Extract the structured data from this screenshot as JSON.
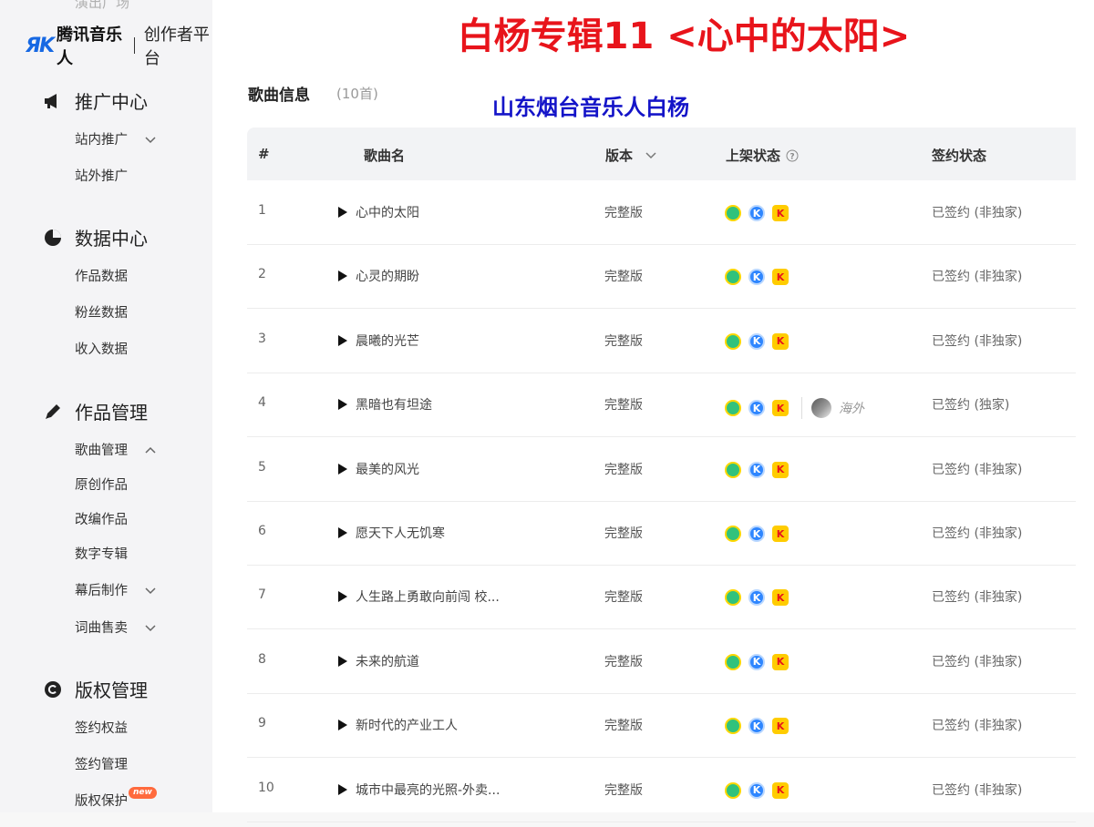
{
  "colors": {
    "accent": "#1668e3",
    "title_red": "#e8141b",
    "artist_blue": "#1414c8",
    "badge_orange": "#ff6a3d"
  },
  "sidebar": {
    "cut_text": "演出广场",
    "logo": {
      "mark": "ЯK",
      "name": "腾讯音乐人",
      "sub": "创作者平台"
    },
    "groups": [
      {
        "label": "推广中心",
        "icon": "megaphone-icon"
      },
      {
        "label": "数据中心",
        "icon": "pie-chart-icon"
      },
      {
        "label": "作品管理",
        "icon": "pencil-icon"
      },
      {
        "label": "版权管理",
        "icon": "copyright-icon"
      }
    ],
    "items": [
      {
        "label": "站内推广"
      },
      {
        "label": "站外推广"
      },
      {
        "label": "作品数据"
      },
      {
        "label": "粉丝数据"
      },
      {
        "label": "收入数据"
      },
      {
        "label": "歌曲管理"
      },
      {
        "label": "原创作品"
      },
      {
        "label": "改编作品"
      },
      {
        "label": "数字专辑"
      },
      {
        "label": "幕后制作"
      },
      {
        "label": "词曲售卖"
      },
      {
        "label": "签约权益"
      },
      {
        "label": "签约管理"
      },
      {
        "label": "版权保护",
        "badge": "new"
      }
    ]
  },
  "overlay": {
    "album_title": "白杨专辑11 <心中的太阳>",
    "artist": "山东烟台音乐人白杨"
  },
  "section": {
    "title": "歌曲信息",
    "count": "(10首)"
  },
  "table": {
    "headers": {
      "index": "#",
      "name": "歌曲名",
      "version": "版本",
      "status": "上架状态",
      "sign": "签约状态"
    },
    "rows": [
      {
        "index": "1",
        "name": "心中的太阳",
        "version": "完整版",
        "sign": "已签约 (非独家)"
      },
      {
        "index": "2",
        "name": "心灵的期盼",
        "version": "完整版",
        "sign": "已签约 (非独家)"
      },
      {
        "index": "3",
        "name": "晨曦的光芒",
        "version": "完整版",
        "sign": "已签约 (非独家)"
      },
      {
        "index": "4",
        "name": "黑暗也有坦途",
        "version": "完整版",
        "sign": "已签约 (独家)",
        "overseas": "海外"
      },
      {
        "index": "5",
        "name": "最美的风光",
        "version": "完整版",
        "sign": "已签约 (非独家)"
      },
      {
        "index": "6",
        "name": "愿天下人无饥寒",
        "version": "完整版",
        "sign": "已签约 (非独家)"
      },
      {
        "index": "7",
        "name": "人生路上勇敢向前闯 校...",
        "version": "完整版",
        "sign": "已签约 (非独家)"
      },
      {
        "index": "8",
        "name": "未来的航道",
        "version": "完整版",
        "sign": "已签约 (非独家)"
      },
      {
        "index": "9",
        "name": "新时代的产业工人",
        "version": "完整版",
        "sign": "已签约 (非独家)"
      },
      {
        "index": "10",
        "name": "城市中最亮的光照-外卖...",
        "version": "完整版",
        "sign": "已签约 (非独家)"
      }
    ]
  }
}
